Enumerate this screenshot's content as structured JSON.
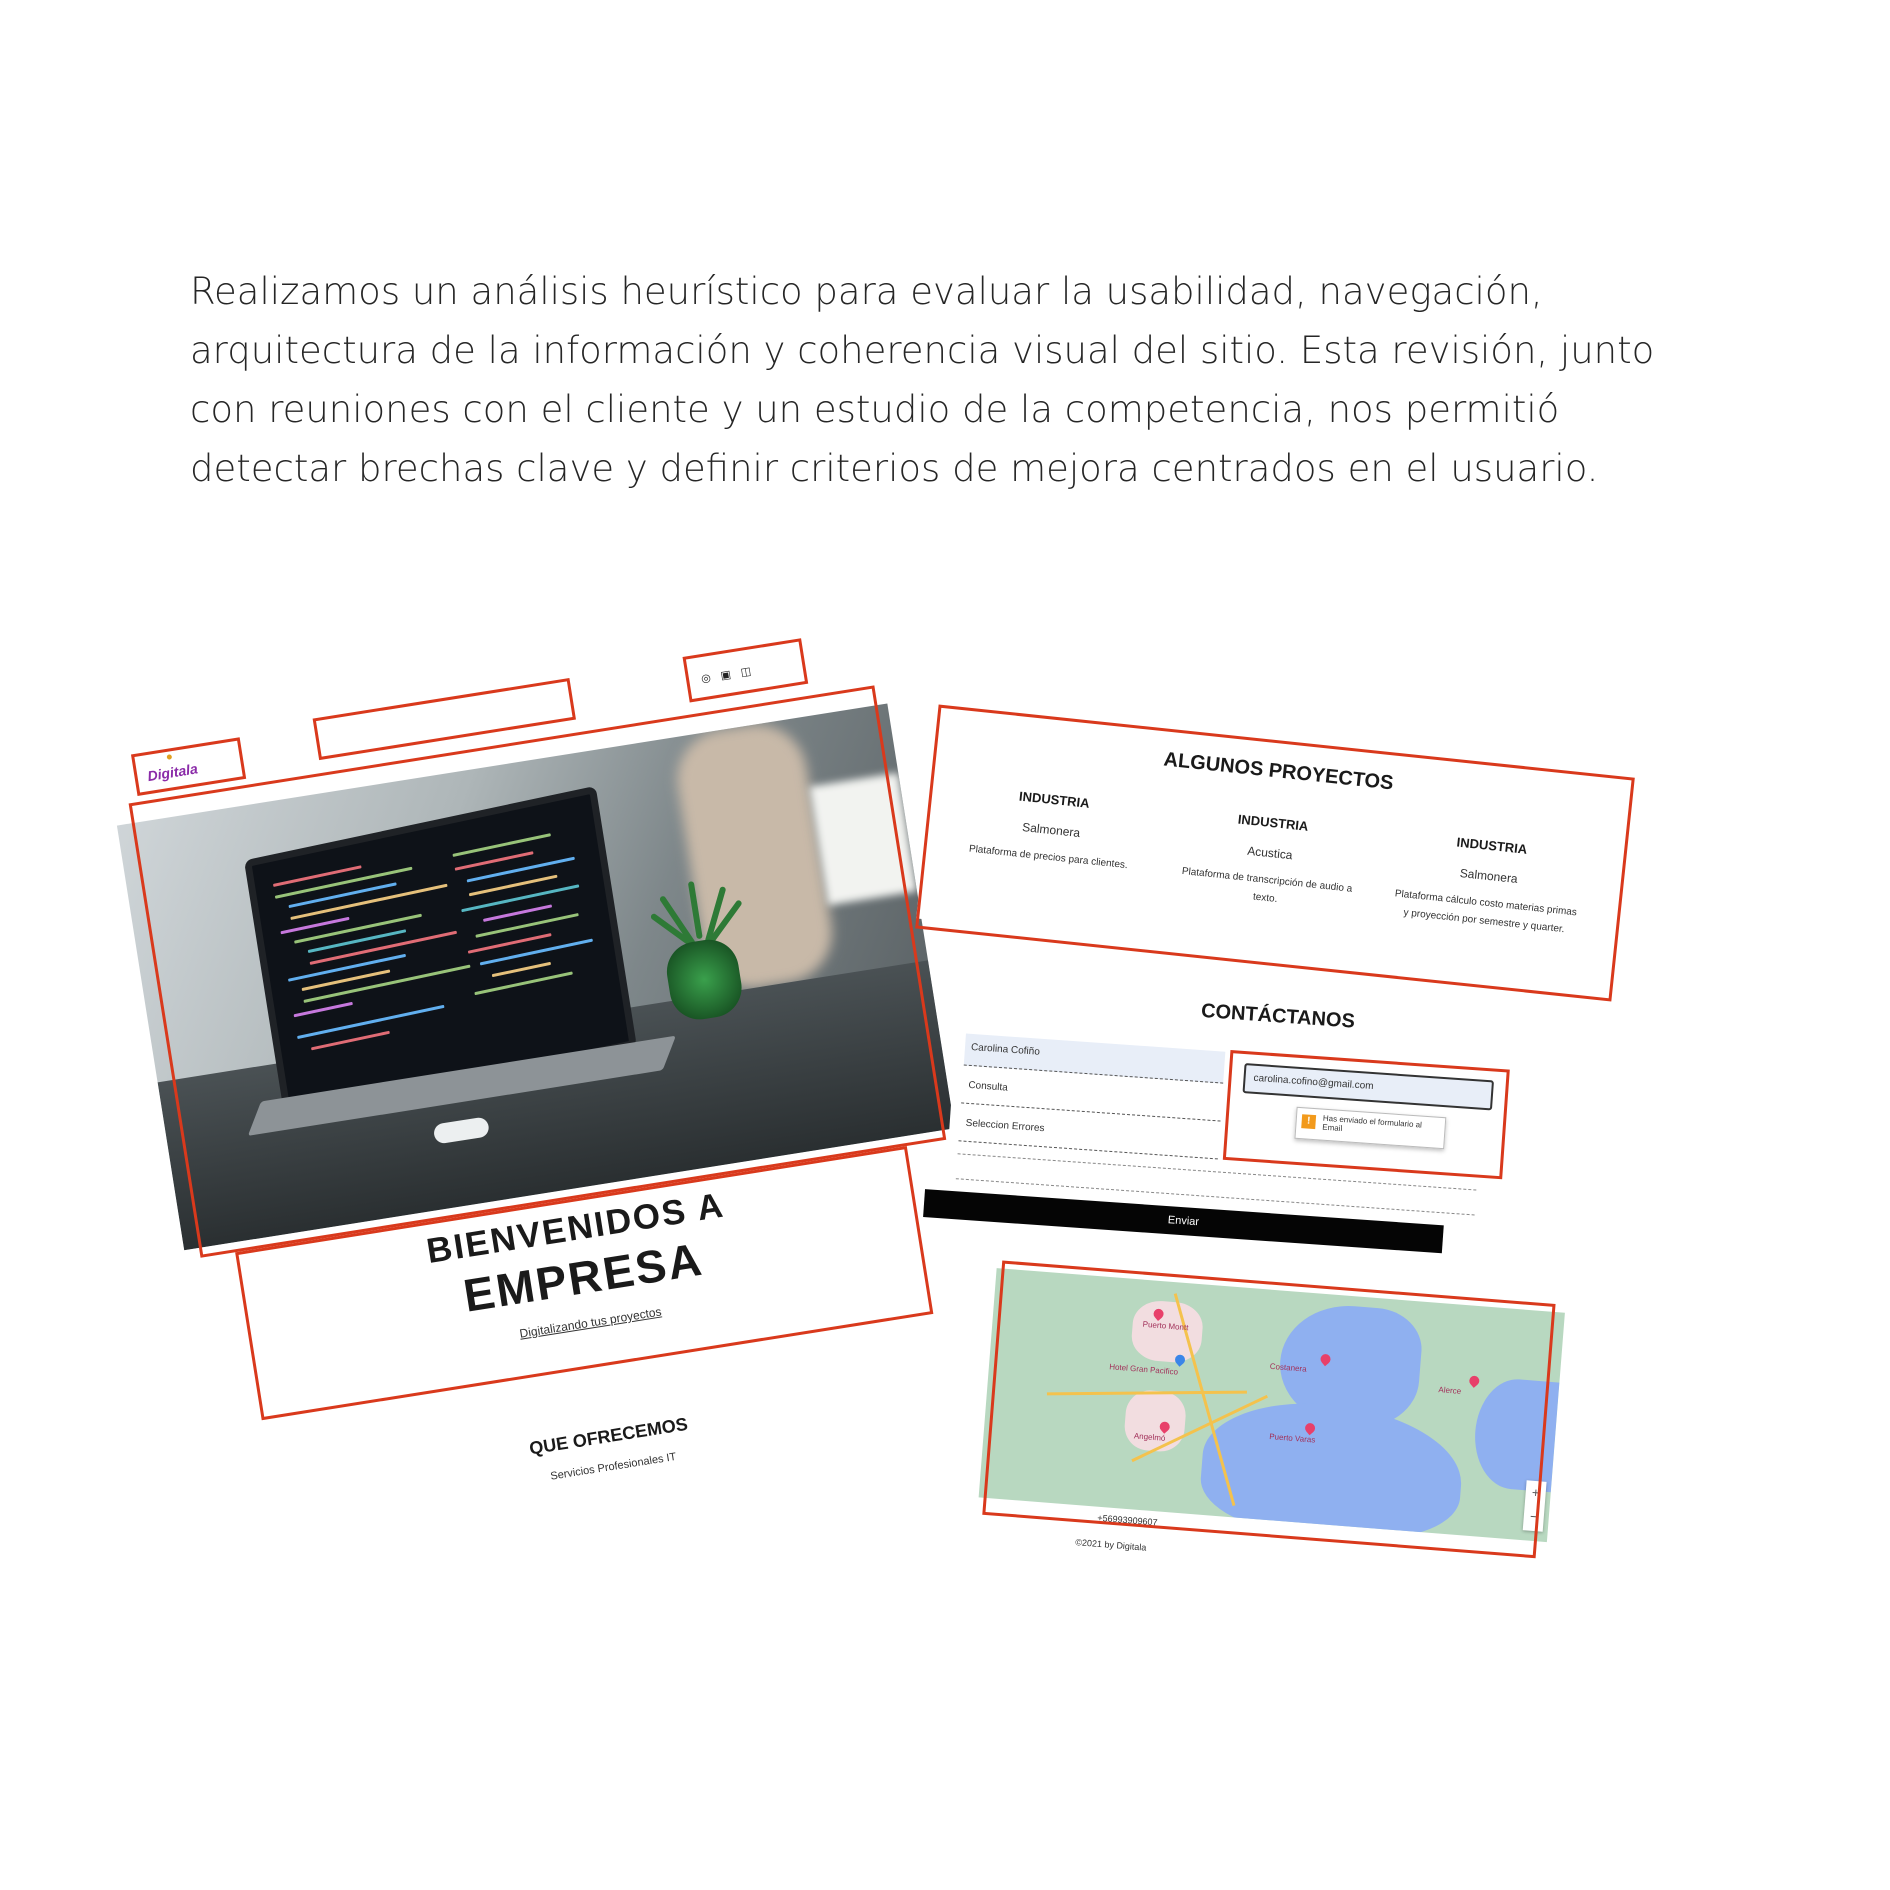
{
  "intro": {
    "text": "Realizamos un análisis heurístico para evaluar la usabilidad, navegación, arquitectura de la información y coherencia visual del sitio. Esta revisión, junto con reuniones con el cliente y un estudio de la competencia, nos permitió detectar brechas clave y definir criterios de mejora centrados en el usuario."
  },
  "left_screen": {
    "logo": "Digitala",
    "social_icons": [
      "whatsapp-icon",
      "linkedin-icon",
      "instagram-icon"
    ],
    "hero": {
      "title_line1": "BIENVENIDOS A",
      "title_line2": "EMPRESA",
      "tagline": "Digitalizando tus proyectos"
    },
    "offer": {
      "title": "QUE OFRECEMOS",
      "subtitle": "Servicios Profesionales IT"
    }
  },
  "projects": {
    "title": "ALGUNOS PROYECTOS",
    "items": [
      {
        "heading": "INDUSTRIA",
        "name": "Salmonera",
        "desc": "Plataforma de precios para clientes."
      },
      {
        "heading": "INDUSTRIA",
        "name": "Acustica",
        "desc": "Plataforma de transcripción de audio a texto."
      },
      {
        "heading": "INDUSTRIA",
        "name": "Salmonera",
        "desc": "Plataforma cálculo costo materias primas y proyección por semestre y quarter."
      }
    ]
  },
  "contact": {
    "title": "CONTÁCTANOS",
    "name_value": "Carolina Cofiño",
    "message_value": "Consulta",
    "last_value": "Seleccion Errores",
    "email_value": "carolina.cofino@gmail.com",
    "tooltip": "Has enviado el formulario al Email",
    "send_label": "Enviar"
  },
  "map_section": {
    "labels": [
      "Puerto Montt",
      "Hotel Gran Pacifico",
      "Angelmó",
      "Costanera",
      "Puerto Varas",
      "Alerce"
    ],
    "phone": "+56993909607",
    "copyright": "©2021 by Digitala"
  },
  "colors": {
    "highlight": "#d9391c",
    "button": "#050505",
    "lake": "#8fb0f0",
    "land": "#b8d8c0"
  }
}
